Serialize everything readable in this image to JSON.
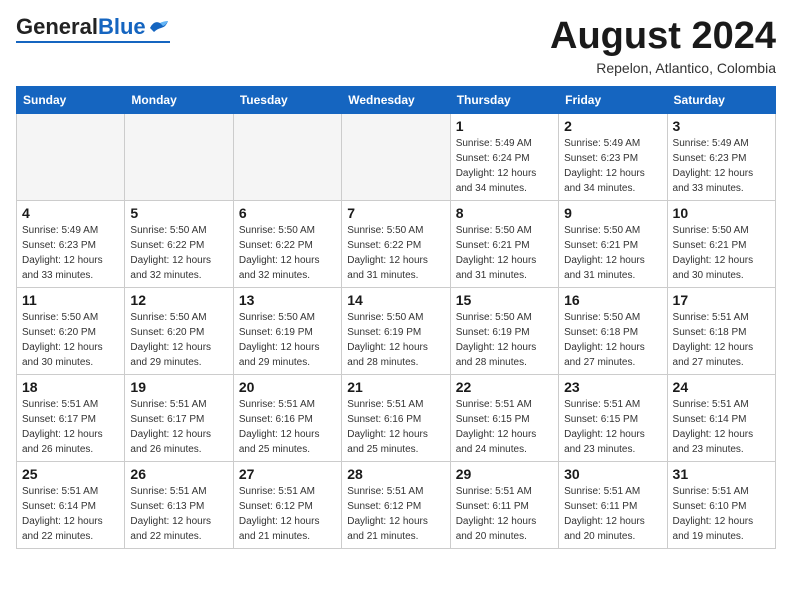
{
  "header": {
    "logo_general": "General",
    "logo_blue": "Blue",
    "month_title": "August 2024",
    "subtitle": "Repelon, Atlantico, Colombia"
  },
  "weekdays": [
    "Sunday",
    "Monday",
    "Tuesday",
    "Wednesday",
    "Thursday",
    "Friday",
    "Saturday"
  ],
  "weeks": [
    [
      {
        "day": "",
        "empty": true
      },
      {
        "day": "",
        "empty": true
      },
      {
        "day": "",
        "empty": true
      },
      {
        "day": "",
        "empty": true
      },
      {
        "day": "1",
        "sunrise": "5:49 AM",
        "sunset": "6:24 PM",
        "daylight": "12 hours and 34 minutes."
      },
      {
        "day": "2",
        "sunrise": "5:49 AM",
        "sunset": "6:23 PM",
        "daylight": "12 hours and 34 minutes."
      },
      {
        "day": "3",
        "sunrise": "5:49 AM",
        "sunset": "6:23 PM",
        "daylight": "12 hours and 33 minutes."
      }
    ],
    [
      {
        "day": "4",
        "sunrise": "5:49 AM",
        "sunset": "6:23 PM",
        "daylight": "12 hours and 33 minutes."
      },
      {
        "day": "5",
        "sunrise": "5:50 AM",
        "sunset": "6:22 PM",
        "daylight": "12 hours and 32 minutes."
      },
      {
        "day": "6",
        "sunrise": "5:50 AM",
        "sunset": "6:22 PM",
        "daylight": "12 hours and 32 minutes."
      },
      {
        "day": "7",
        "sunrise": "5:50 AM",
        "sunset": "6:22 PM",
        "daylight": "12 hours and 31 minutes."
      },
      {
        "day": "8",
        "sunrise": "5:50 AM",
        "sunset": "6:21 PM",
        "daylight": "12 hours and 31 minutes."
      },
      {
        "day": "9",
        "sunrise": "5:50 AM",
        "sunset": "6:21 PM",
        "daylight": "12 hours and 31 minutes."
      },
      {
        "day": "10",
        "sunrise": "5:50 AM",
        "sunset": "6:21 PM",
        "daylight": "12 hours and 30 minutes."
      }
    ],
    [
      {
        "day": "11",
        "sunrise": "5:50 AM",
        "sunset": "6:20 PM",
        "daylight": "12 hours and 30 minutes."
      },
      {
        "day": "12",
        "sunrise": "5:50 AM",
        "sunset": "6:20 PM",
        "daylight": "12 hours and 29 minutes."
      },
      {
        "day": "13",
        "sunrise": "5:50 AM",
        "sunset": "6:19 PM",
        "daylight": "12 hours and 29 minutes."
      },
      {
        "day": "14",
        "sunrise": "5:50 AM",
        "sunset": "6:19 PM",
        "daylight": "12 hours and 28 minutes."
      },
      {
        "day": "15",
        "sunrise": "5:50 AM",
        "sunset": "6:19 PM",
        "daylight": "12 hours and 28 minutes."
      },
      {
        "day": "16",
        "sunrise": "5:50 AM",
        "sunset": "6:18 PM",
        "daylight": "12 hours and 27 minutes."
      },
      {
        "day": "17",
        "sunrise": "5:51 AM",
        "sunset": "6:18 PM",
        "daylight": "12 hours and 27 minutes."
      }
    ],
    [
      {
        "day": "18",
        "sunrise": "5:51 AM",
        "sunset": "6:17 PM",
        "daylight": "12 hours and 26 minutes."
      },
      {
        "day": "19",
        "sunrise": "5:51 AM",
        "sunset": "6:17 PM",
        "daylight": "12 hours and 26 minutes."
      },
      {
        "day": "20",
        "sunrise": "5:51 AM",
        "sunset": "6:16 PM",
        "daylight": "12 hours and 25 minutes."
      },
      {
        "day": "21",
        "sunrise": "5:51 AM",
        "sunset": "6:16 PM",
        "daylight": "12 hours and 25 minutes."
      },
      {
        "day": "22",
        "sunrise": "5:51 AM",
        "sunset": "6:15 PM",
        "daylight": "12 hours and 24 minutes."
      },
      {
        "day": "23",
        "sunrise": "5:51 AM",
        "sunset": "6:15 PM",
        "daylight": "12 hours and 23 minutes."
      },
      {
        "day": "24",
        "sunrise": "5:51 AM",
        "sunset": "6:14 PM",
        "daylight": "12 hours and 23 minutes."
      }
    ],
    [
      {
        "day": "25",
        "sunrise": "5:51 AM",
        "sunset": "6:14 PM",
        "daylight": "12 hours and 22 minutes."
      },
      {
        "day": "26",
        "sunrise": "5:51 AM",
        "sunset": "6:13 PM",
        "daylight": "12 hours and 22 minutes."
      },
      {
        "day": "27",
        "sunrise": "5:51 AM",
        "sunset": "6:12 PM",
        "daylight": "12 hours and 21 minutes."
      },
      {
        "day": "28",
        "sunrise": "5:51 AM",
        "sunset": "6:12 PM",
        "daylight": "12 hours and 21 minutes."
      },
      {
        "day": "29",
        "sunrise": "5:51 AM",
        "sunset": "6:11 PM",
        "daylight": "12 hours and 20 minutes."
      },
      {
        "day": "30",
        "sunrise": "5:51 AM",
        "sunset": "6:11 PM",
        "daylight": "12 hours and 20 minutes."
      },
      {
        "day": "31",
        "sunrise": "5:51 AM",
        "sunset": "6:10 PM",
        "daylight": "12 hours and 19 minutes."
      }
    ]
  ]
}
